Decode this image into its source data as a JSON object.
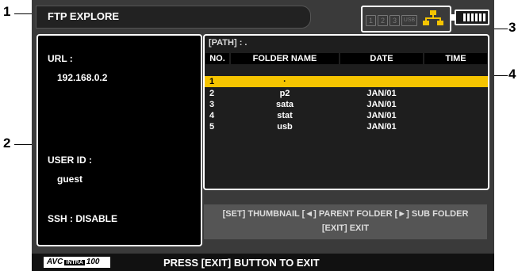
{
  "callouts": [
    "1",
    "2",
    "3",
    "4"
  ],
  "title": "FTP EXPLORE",
  "device_slots": [
    "1",
    "2",
    "3",
    "USB"
  ],
  "icons": {
    "network": "network-icon",
    "battery": "battery-icon"
  },
  "login": {
    "url_label": "URL :",
    "url_value": "192.168.0.2",
    "user_label": "USER ID :",
    "user_value": "guest",
    "ssh": "SSH : DISABLE"
  },
  "browser": {
    "path": "[PATH] : .",
    "columns": [
      "NO.",
      "FOLDER NAME",
      "DATE",
      "TIME"
    ],
    "rows": [
      {
        "no": "1",
        "name": "·",
        "date": "",
        "time": ""
      },
      {
        "no": "2",
        "name": "p2",
        "date": "JAN/01",
        "time": ""
      },
      {
        "no": "3",
        "name": "sata",
        "date": "JAN/01",
        "time": ""
      },
      {
        "no": "4",
        "name": "stat",
        "date": "JAN/01",
        "time": ""
      },
      {
        "no": "5",
        "name": "usb",
        "date": "JAN/01",
        "time": ""
      }
    ],
    "selected_index": 0
  },
  "help": {
    "line1": "[SET] THUMBNAIL  [◄] PARENT FOLDER  [►] SUB FOLDER",
    "line2": "[EXIT] EXIT"
  },
  "bottom": {
    "logo_avc": "AVC",
    "logo_intra": "INTRA",
    "logo_num": "100",
    "message": "PRESS [EXIT] BUTTON TO EXIT"
  },
  "colors": {
    "selected_row": "#f5c400",
    "screen_bg": "#3a3a3a"
  }
}
